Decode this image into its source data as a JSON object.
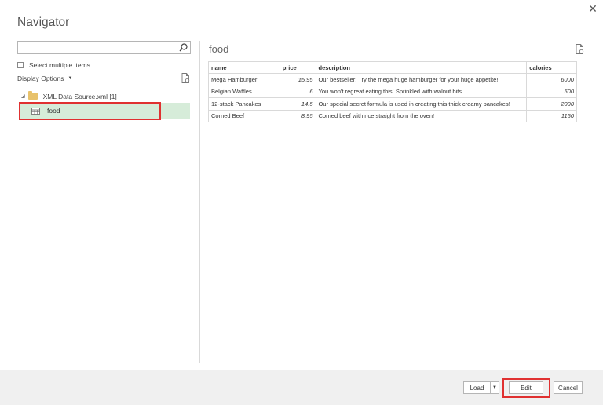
{
  "window": {
    "title": "Navigator",
    "close_icon": "close-icon"
  },
  "left_pane": {
    "search_value": "",
    "search_icon": "search-icon",
    "select_multiple_label": "Select multiple items",
    "select_multiple_checked": false,
    "display_options_label": "Display Options",
    "tree": {
      "source_label": "XML Data Source.xml [1]",
      "source_expanded": true,
      "items": [
        {
          "label": "food",
          "selected": true,
          "icon": "table-icon"
        }
      ]
    }
  },
  "preview": {
    "title": "food",
    "columns": [
      "name",
      "price",
      "description",
      "calories"
    ],
    "rows": [
      [
        "Mega Hamburger",
        "15.95",
        "Our bestseller! Try the mega huge hamburger for your huge appetite!",
        "6000"
      ],
      [
        "Belgian Waffles",
        "6",
        "You won't regreat eating this! Sprinkled with walnut bits.",
        "500"
      ],
      [
        "12-stack Pancakes",
        "14.5",
        "Our special secret formula is used in creating this thick creamy pancakes!",
        "2000"
      ],
      [
        "Corned Beef",
        "8.95",
        "Corned beef with rice straight from the oven!",
        "1150"
      ]
    ]
  },
  "footer": {
    "load_label": "Load",
    "edit_label": "Edit",
    "cancel_label": "Cancel"
  },
  "colors": {
    "selected_row_bg": "#d6ecd9",
    "highlight_red": "#e03131",
    "footer_bg": "#f0f0f0",
    "folder": "#e8c26b"
  }
}
